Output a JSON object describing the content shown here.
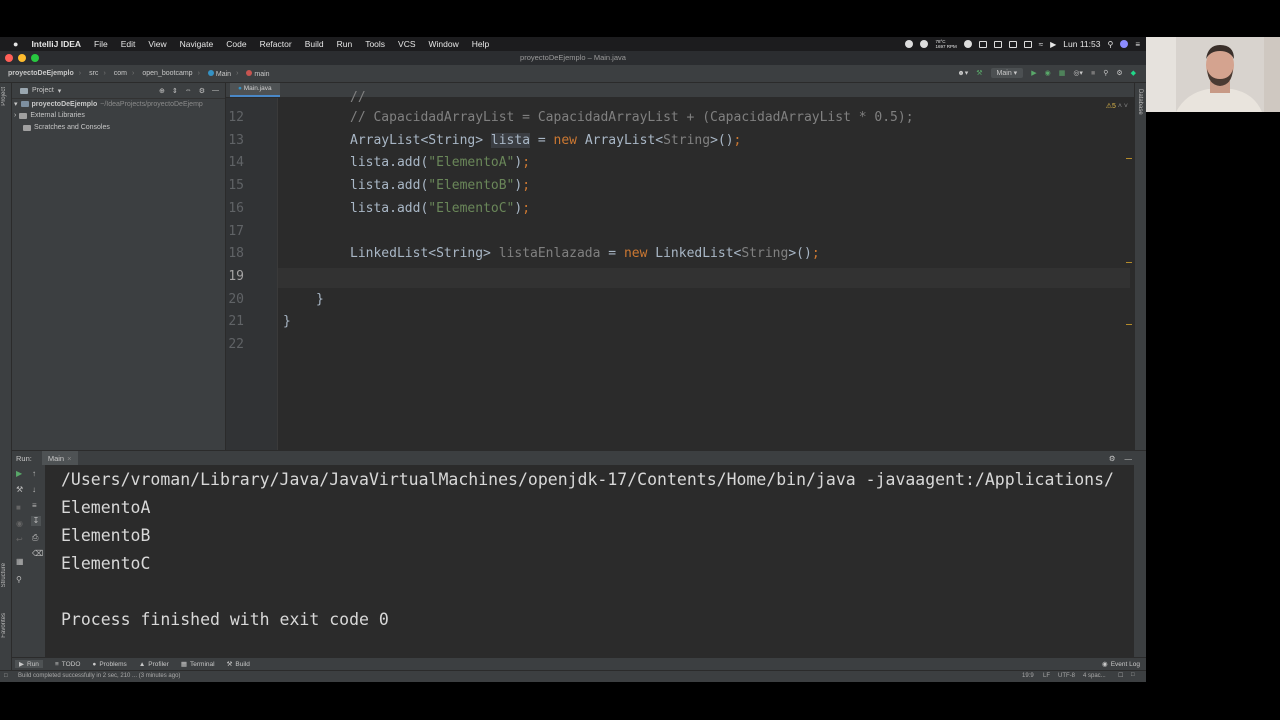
{
  "menubar": {
    "app": "IntelliJ IDEA",
    "items": [
      "File",
      "Edit",
      "View",
      "Navigate",
      "Code",
      "Refactor",
      "Build",
      "Run",
      "Tools",
      "VCS",
      "Window",
      "Help"
    ],
    "temp": "78°C",
    "rpm": "1697 RPM",
    "clock": "Lun 11:53"
  },
  "window": {
    "title": "proyectoDeEjemplo – Main.java"
  },
  "navbar": {
    "crumbs": [
      "proyectoDeEjemplo",
      "src",
      "com",
      "open_bootcamp",
      "Main",
      "main"
    ],
    "run_config": "Main"
  },
  "project_panel": {
    "title": "Project",
    "root_name": "proyectoDeEjemplo",
    "root_path": "~/IdeaProjects/proyectoDeEjemp",
    "items": [
      "External Libraries",
      "Scratches and Consoles"
    ]
  },
  "left_strip": {
    "project_label": "Project",
    "structure_label": "Structure",
    "favorites_label": "Favorites"
  },
  "right_strip": {
    "database_label": "Database"
  },
  "editor": {
    "tab": "Main.java",
    "warnings": "5",
    "lines": [
      {
        "num": "12",
        "text": "// CapacidadArrayList = CapacidadArrayList + (CapacidadArrayList * 0.5);"
      },
      {
        "num": "13",
        "text": "ArrayList<String> lista = new ArrayList<String>();"
      },
      {
        "num": "14",
        "text": "lista.add(\"ElementoA\");"
      },
      {
        "num": "15",
        "text": "lista.add(\"ElementoB\");"
      },
      {
        "num": "16",
        "text": "lista.add(\"ElementoC\");"
      },
      {
        "num": "17",
        "text": ""
      },
      {
        "num": "18",
        "text": "LinkedList<String> listaEnlazada = new LinkedList<String>();"
      },
      {
        "num": "19",
        "text": ""
      },
      {
        "num": "20",
        "text": "}"
      },
      {
        "num": "21",
        "text": "}"
      },
      {
        "num": "22",
        "text": ""
      }
    ],
    "prev_line_fragment": "//"
  },
  "run_panel": {
    "label": "Run:",
    "tab": "Main",
    "output": [
      "/Users/vroman/Library/Java/JavaVirtualMachines/openjdk-17/Contents/Home/bin/java -javaagent:/Applications/",
      "ElementoA",
      "ElementoB",
      "ElementoC",
      "",
      "Process finished with exit code 0"
    ]
  },
  "bottom_tabs": [
    "Run",
    "TODO",
    "Problems",
    "Profiler",
    "Terminal",
    "Build"
  ],
  "event_log": "Event Log",
  "status": {
    "message": "Build completed successfully in 2 sec, 210 ... (3 minutes ago)",
    "position": "19:9",
    "line_sep": "LF",
    "encoding": "UTF-8",
    "indent": "4 spac..."
  }
}
